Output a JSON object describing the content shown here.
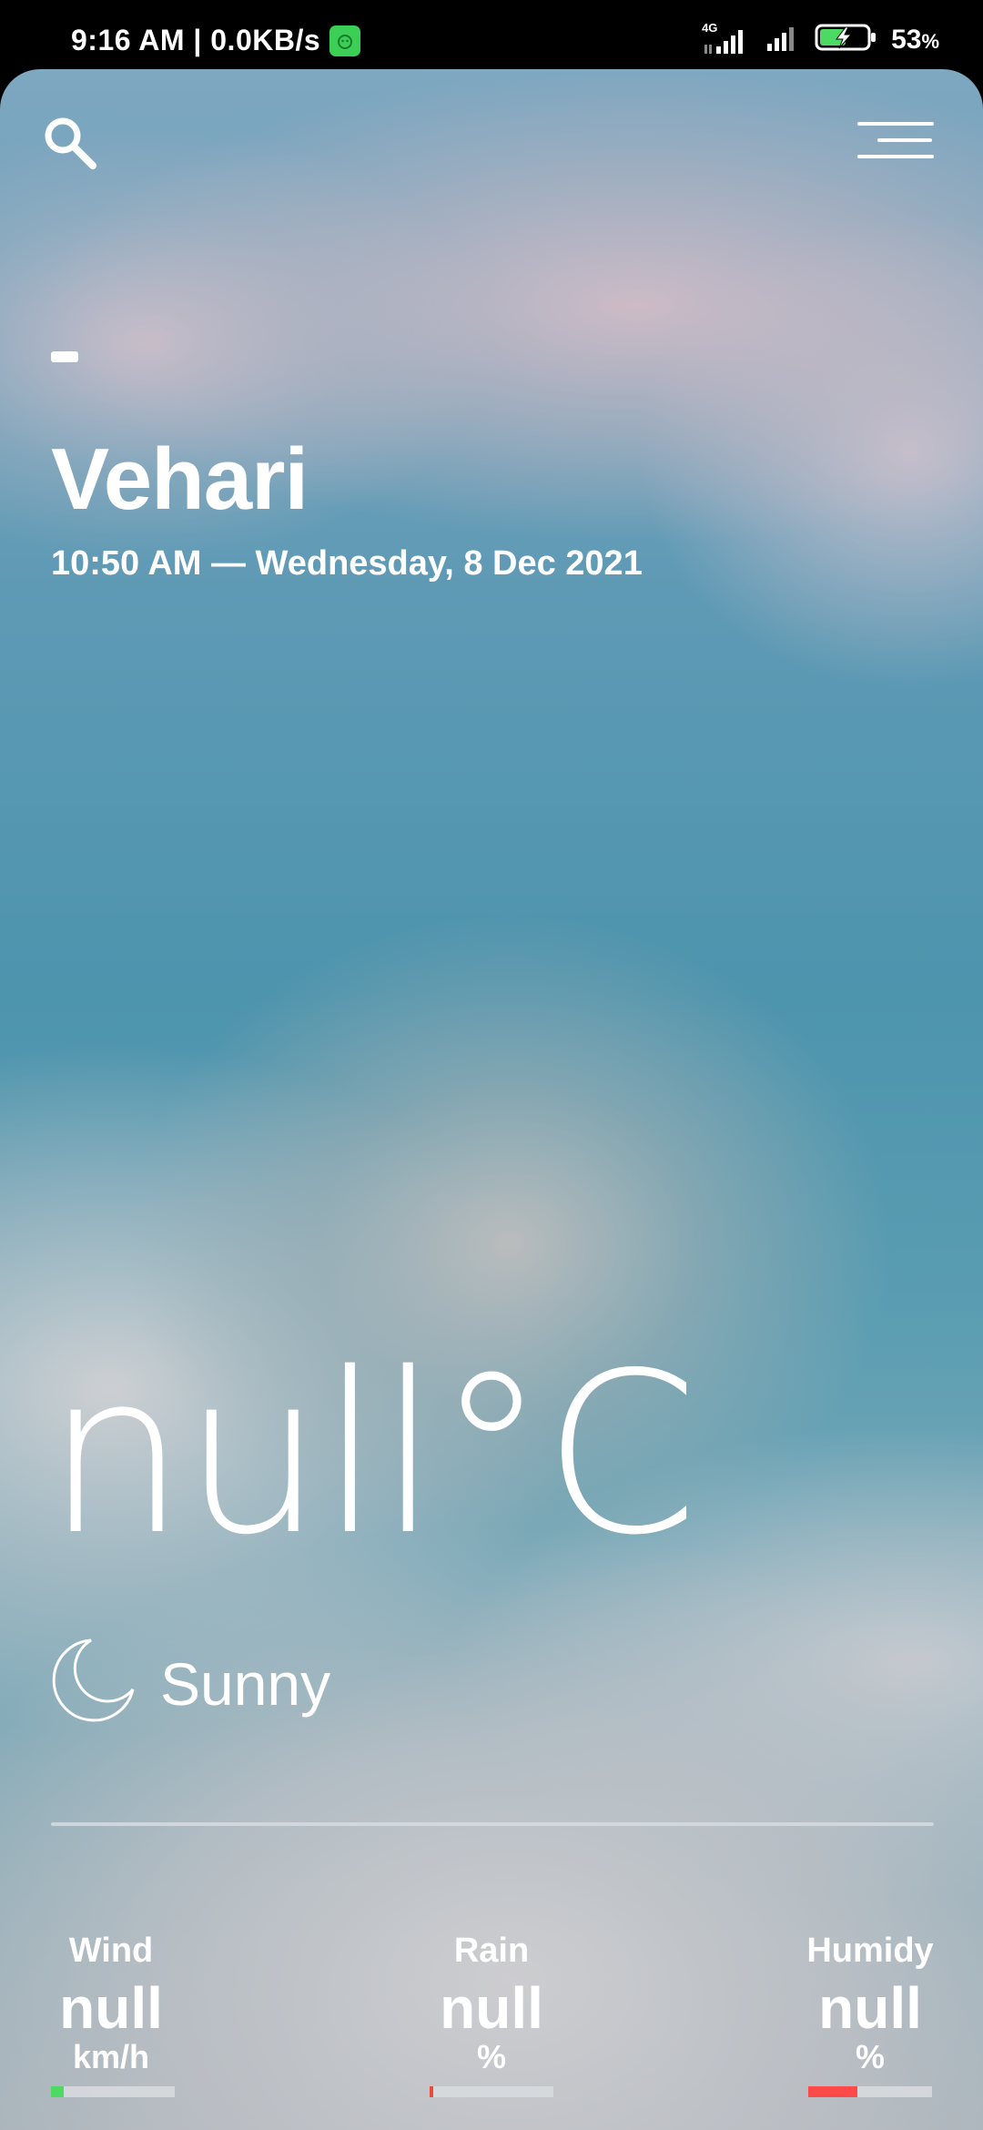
{
  "status_bar": {
    "time_speed": "9:16 AM | 0.0KB/s",
    "network": "4G",
    "battery": "53",
    "battery_unit": "%"
  },
  "header": {
    "search_icon": "search-icon",
    "menu_icon": "menu-icon"
  },
  "location": {
    "city": "Vehari",
    "datetime": "10:50 AM — Wednesday, 8 Dec 2021"
  },
  "current": {
    "temperature": "null°C",
    "condition": "Sunny",
    "condition_icon": "moon-icon"
  },
  "stats": {
    "wind": {
      "label": "Wind",
      "value": "null",
      "unit": "km/h",
      "level": 0.1,
      "color": "#4cd964"
    },
    "rain": {
      "label": "Rain",
      "value": "null",
      "unit": "%",
      "level": 0.02,
      "color": "#e74c3c"
    },
    "humidity": {
      "label": "Humidy",
      "value": "null",
      "unit": "%",
      "level": 0.4,
      "color": "#ff4a4a"
    }
  }
}
